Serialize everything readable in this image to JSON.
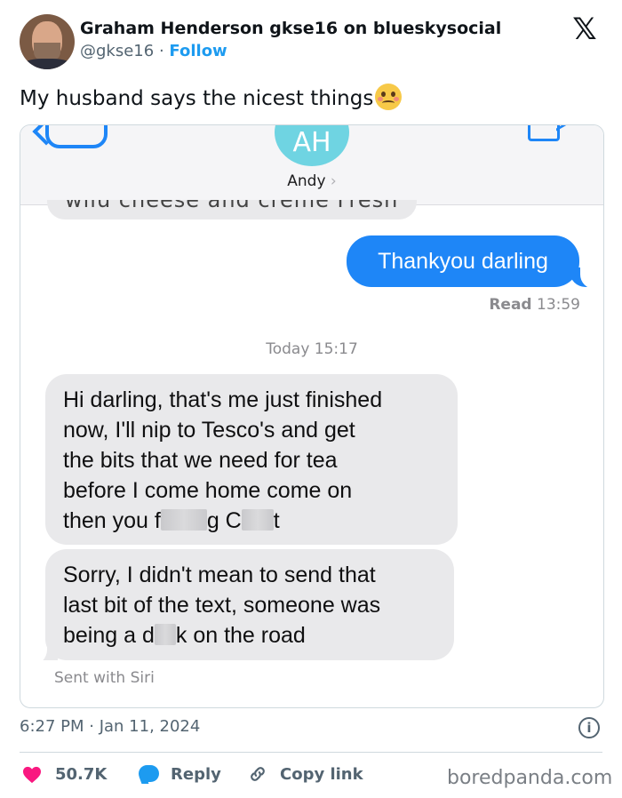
{
  "post": {
    "author_name": "Graham Henderson gkse16 on blueskysocial",
    "handle": "@gkse16",
    "separator": "·",
    "follow_label": "Follow",
    "text": "My husband says the nicest things",
    "timestamp": "6:27 PM · Jan 11, 2024",
    "likes": "50.7K",
    "reply_label": "Reply",
    "copy_link_label": "Copy link",
    "platform_icon": "x-logo-icon",
    "text_emoji": "woozy-face-emoji"
  },
  "screenshot": {
    "avatar_initials": "AH",
    "contact_name": "Andy",
    "contact_chevron": "›",
    "sent_message": "Thankyou darling",
    "read_label": "Read",
    "read_time": "13:59",
    "date_divider": "Today 15:17",
    "received_1": {
      "line1": "Hi darling, that's me just finished",
      "line2": "now, I'll nip to Tesco's and get",
      "line3": "the bits that we need for tea",
      "line4": "before I come home come on",
      "line5_a": "then you f",
      "line5_b": "g C",
      "line5_c": "t"
    },
    "received_2": {
      "line1": "Sorry, I didn't mean to send that",
      "line2": "last bit of the text, someone was",
      "line3_a": "being a d",
      "line3_b": "k on the road"
    },
    "footer_note": "Sent with Siri"
  },
  "watermark": "boredpanda.com",
  "colors": {
    "link_blue": "#1d9bf0",
    "imessage_blue": "#1e86f7",
    "like_pink": "#f91880",
    "muted_gray": "#536471"
  }
}
